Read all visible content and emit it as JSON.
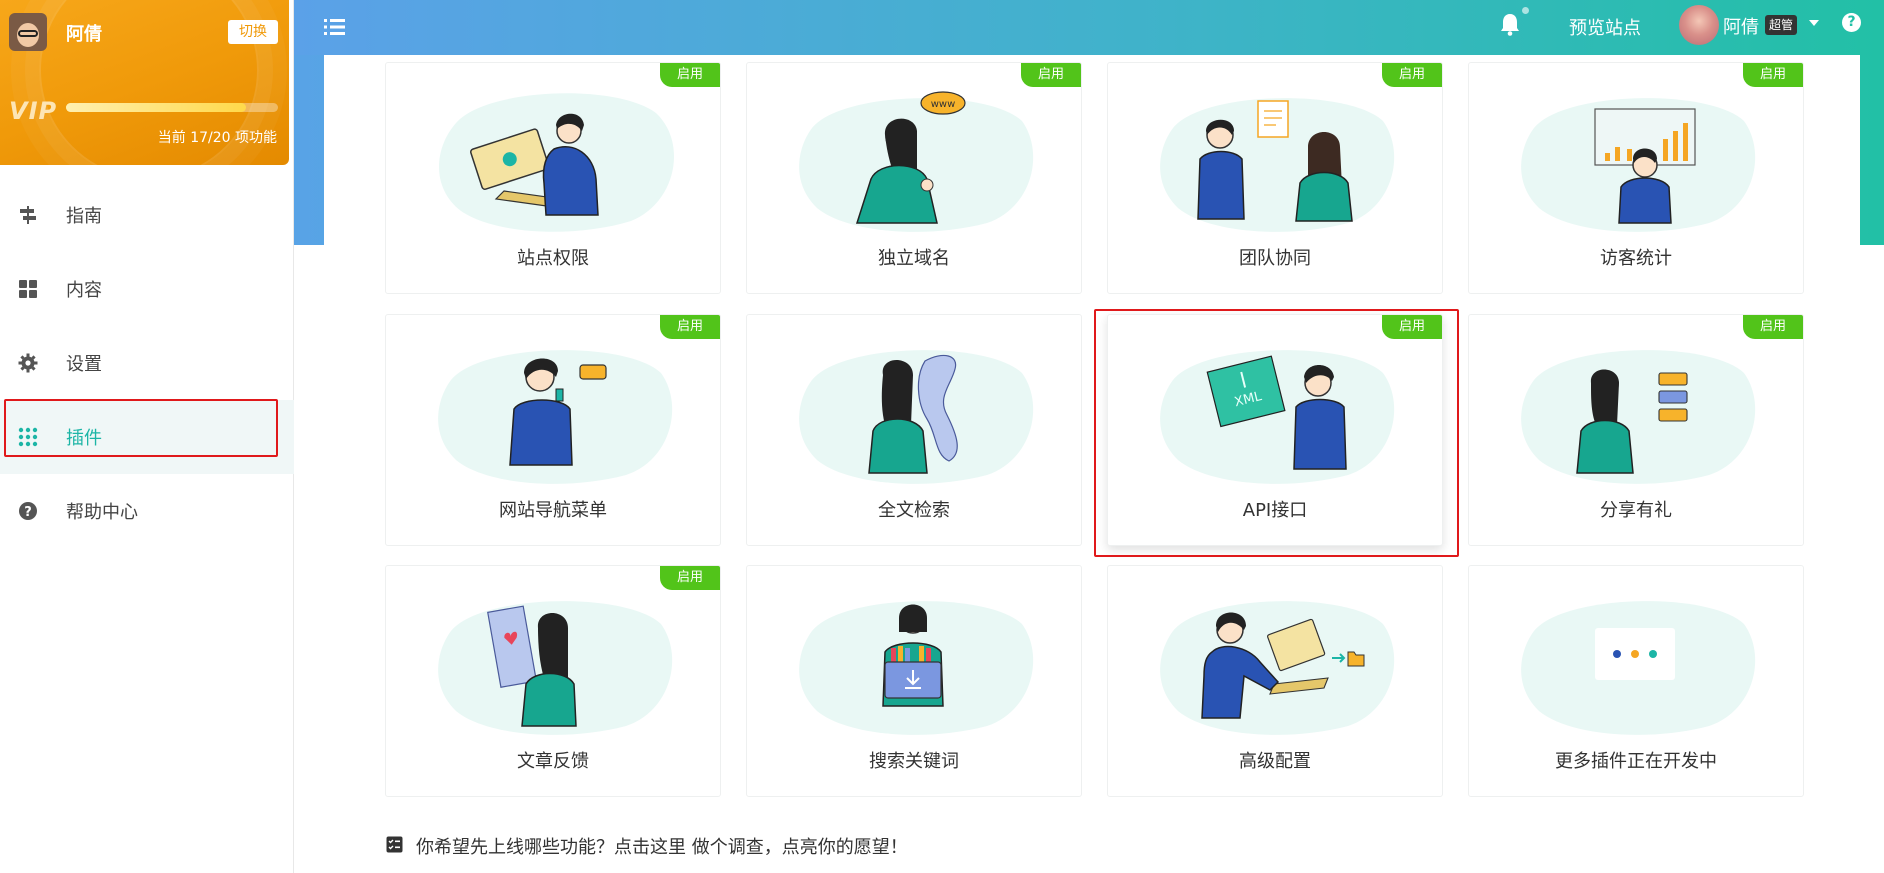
{
  "sidebar": {
    "user": {
      "name": "阿倩",
      "switch_label": "切换"
    },
    "vip": {
      "label": "VIP",
      "progress": 0.85,
      "note": "当前 17/20 项功能"
    },
    "nav": [
      {
        "label": "指南",
        "icon": "signpost-icon"
      },
      {
        "label": "内容",
        "icon": "grid-icon"
      },
      {
        "label": "设置",
        "icon": "gear-icon"
      },
      {
        "label": "插件",
        "icon": "apps-icon",
        "active": true
      },
      {
        "label": "帮助中心",
        "icon": "question-circle-icon"
      }
    ]
  },
  "topbar": {
    "preview_label": "预览站点",
    "user_name": "阿倩",
    "role_badge": "超管",
    "help_label": "?"
  },
  "plugins": [
    {
      "title": "站点权限",
      "tag": "启用"
    },
    {
      "title": "独立域名",
      "tag": "启用"
    },
    {
      "title": "团队协同",
      "tag": "启用"
    },
    {
      "title": "访客统计",
      "tag": "启用"
    },
    {
      "title": "网站导航菜单",
      "tag": "启用"
    },
    {
      "title": "全文检索",
      "tag": ""
    },
    {
      "title": "API接口",
      "tag": "启用"
    },
    {
      "title": "分享有礼",
      "tag": "启用"
    },
    {
      "title": "文章反馈",
      "tag": "启用"
    },
    {
      "title": "搜索关键词",
      "tag": ""
    },
    {
      "title": "高级配置",
      "tag": ""
    },
    {
      "title": "更多插件正在开发中",
      "tag": ""
    }
  ],
  "survey": {
    "text": "你希望先上线哪些功能？点击这里 做个调查，点亮你的愿望！"
  },
  "illustration_labels": {
    "www": "www",
    "xml": "XML"
  },
  "colors": {
    "accent": "#1cb5a6",
    "tag_green": "#52c41a",
    "highlight_red": "#e0191b",
    "vip_orange": "#f09a0a"
  }
}
